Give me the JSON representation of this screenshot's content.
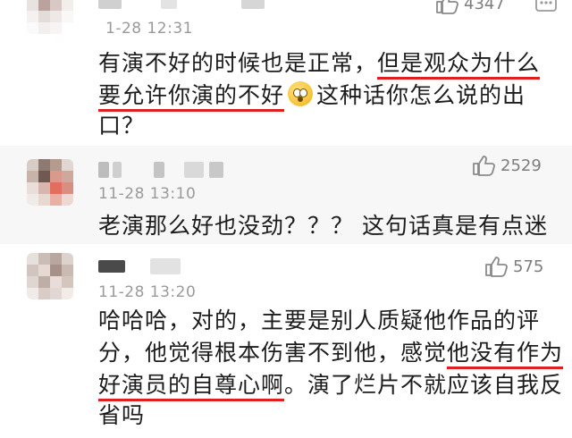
{
  "comments": [
    {
      "timestamp": "1-28 12:31",
      "likes": "4347",
      "more_icon": "ellipsis-icon",
      "lines": [
        [
          {
            "t": "有演不好的时候也是正常，"
          },
          {
            "t": "但是观众为什么",
            "ul": true
          }
        ],
        [
          {
            "t": "要允许你演的不好",
            "ul": true
          },
          {
            "emoji": "flushed-face-icon"
          },
          {
            "t": "这种话你怎么说的出"
          }
        ],
        [
          {
            "t": "口？"
          }
        ]
      ]
    },
    {
      "timestamp": "11-28 13:10",
      "likes": "2529",
      "lines": [
        [
          {
            "t": "老演那么好也没劲？？？ 这句话真是有点迷"
          }
        ]
      ]
    },
    {
      "timestamp": "11-28 13:20",
      "likes": "575",
      "lines": [
        [
          {
            "t": "哈哈哈，对的，主要是别人质疑他作品的评"
          }
        ],
        [
          {
            "t": "分，他觉得根本伤害不到他，感觉"
          },
          {
            "t": "他没有作为",
            "ul": true
          }
        ],
        [
          {
            "t": "好演员的自尊心啊",
            "ul": true
          },
          {
            "t": "。演了烂片不就应该自我反"
          }
        ],
        [
          {
            "t": "省吗"
          }
        ]
      ]
    }
  ],
  "colors": {
    "underline": "#e02020",
    "timestamp": "#9a9a9a",
    "likes": "#7d7d7d",
    "alt_background": "#f7f7f7"
  },
  "icons": {
    "like": "thumbs-up-icon"
  }
}
